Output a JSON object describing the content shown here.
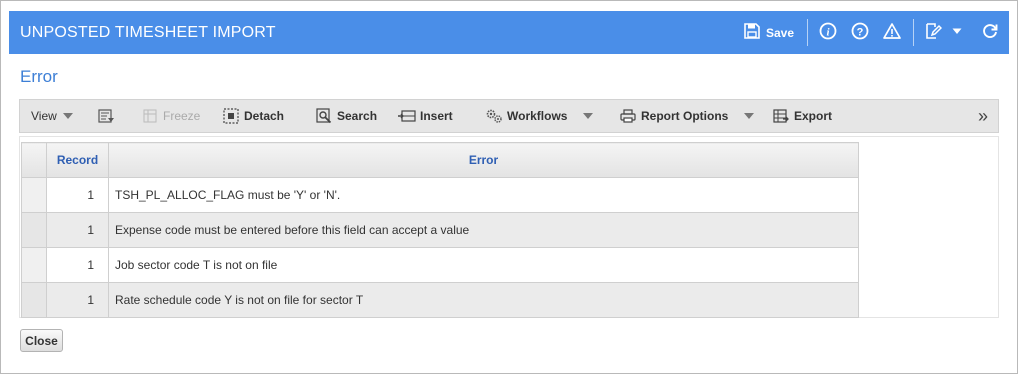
{
  "window": {
    "title": "UNPOSTED TIMESHEET IMPORT",
    "save_label": "Save",
    "accent_color": "#4a8ee8",
    "icons": [
      "save-icon",
      "info-icon",
      "help-icon",
      "warning-icon",
      "edit-icon",
      "chevron-down-icon",
      "refresh-icon"
    ]
  },
  "section": {
    "title": "Error"
  },
  "toolbar": {
    "view": "View",
    "freeze": "Freeze",
    "detach": "Detach",
    "search": "Search",
    "insert": "Insert",
    "workflows": "Workflows",
    "report_options": "Report Options",
    "export": "Export",
    "more": "»"
  },
  "table": {
    "columns": [
      "Record",
      "Error"
    ],
    "rows": [
      {
        "record": "1",
        "error": "TSH_PL_ALLOC_FLAG must be 'Y' or 'N'."
      },
      {
        "record": "1",
        "error": "Expense code must be entered before this field can accept a value"
      },
      {
        "record": "1",
        "error": "Job sector code T is not on file"
      },
      {
        "record": "1",
        "error": "Rate schedule code Y is not on file for sector T"
      }
    ]
  },
  "footer": {
    "close_label": "Close"
  }
}
